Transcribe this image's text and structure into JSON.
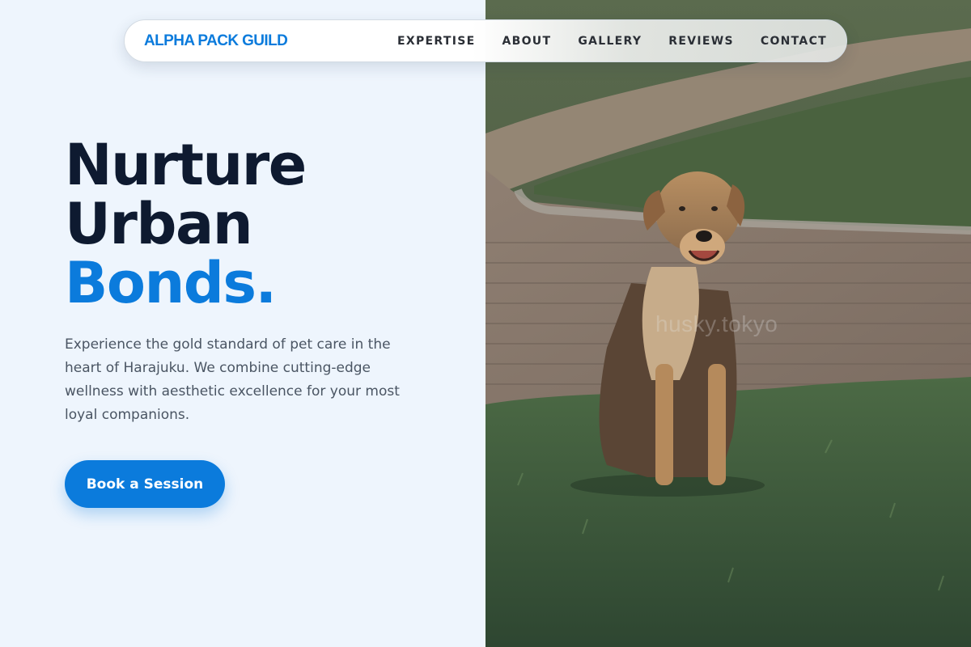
{
  "brand": {
    "name": "ALPHA PACK GUILD"
  },
  "nav": {
    "items": [
      {
        "label": "EXPERTISE"
      },
      {
        "label": "ABOUT"
      },
      {
        "label": "GALLERY"
      },
      {
        "label": "REVIEWS"
      },
      {
        "label": "CONTACT"
      }
    ]
  },
  "hero": {
    "headline_line1": "Nurture",
    "headline_line2": "Urban",
    "headline_accent": "Bonds.",
    "description": "Experience the gold standard of pet care in the heart of Harajuku. We combine cutting-edge wellness with aesthetic excellence for your most loyal companions.",
    "cta_label": "Book a Session"
  },
  "photo": {
    "watermark": "husky.tokyo",
    "subject": "dog-sitting-on-grass"
  },
  "colors": {
    "accent": "#0b7bdc",
    "heading": "#0e1a30",
    "body_text": "#4a5563",
    "page_bg": "#eef5fd"
  }
}
